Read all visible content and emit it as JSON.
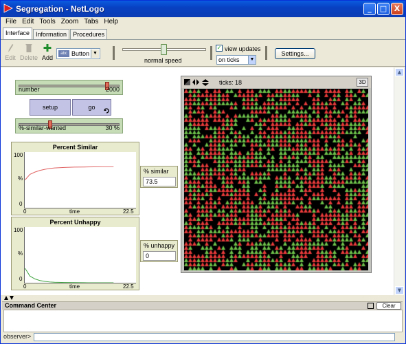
{
  "window": {
    "title": "Segregation - NetLogo",
    "min_glyph": "_",
    "max_glyph": "□",
    "close_glyph": "X"
  },
  "menu": [
    "File",
    "Edit",
    "Tools",
    "Zoom",
    "Tabs",
    "Help"
  ],
  "tabs": [
    "Interface",
    "Information",
    "Procedures"
  ],
  "toolbar": {
    "edit": "Edit",
    "delete": "Delete",
    "add": "Add",
    "widget_type": "Button",
    "widget_abc": "abc",
    "speed_label": "normal speed",
    "speed_fraction": 0.5,
    "view_updates_label": "view updates",
    "view_updates_checked": "✓",
    "update_mode": "on ticks",
    "settings": "Settings..."
  },
  "widgets": {
    "number": {
      "label": "number",
      "value": "2000",
      "fraction": 0.88
    },
    "setup": "setup",
    "go": "go",
    "go_icon": "forever-icon",
    "similar": {
      "label": "%-similar-wanted",
      "value": "30 %",
      "fraction": 0.3
    },
    "plot_similar": {
      "title": "Percent Similar",
      "ymax": "100",
      "ymin": "0",
      "xmin": "0",
      "xmax": "22.5",
      "xlabel": "time",
      "ylabel": "%"
    },
    "plot_unhappy": {
      "title": "Percent Unhappy",
      "ymax": "100",
      "ymin": "0",
      "xmin": "0",
      "xmax": "22.5",
      "xlabel": "time",
      "ylabel": "%"
    },
    "mon_similar": {
      "label": "% similar",
      "value": "73.5"
    },
    "mon_unhappy": {
      "label": "% unhappy",
      "value": "0"
    }
  },
  "view": {
    "ticks": "ticks: 18",
    "three_d": "3D"
  },
  "command_center": {
    "title": "Command Center",
    "clear": "Clear",
    "prompt": "observer>"
  },
  "colors": {
    "red_turtle": "#e83a3a",
    "green_turtle": "#6cc04a",
    "plot_line_similar": "#e06060",
    "plot_line_unhappy": "#3fa33f"
  },
  "chart_data": [
    {
      "type": "line",
      "title": "Percent Similar",
      "xlabel": "time",
      "ylabel": "%",
      "xlim": [
        0,
        22.5
      ],
      "ylim": [
        0,
        100
      ],
      "series": [
        {
          "name": "",
          "x": [
            0,
            1,
            2,
            3,
            4,
            5,
            6,
            8,
            10,
            12,
            14,
            16,
            18
          ],
          "y": [
            50,
            60,
            64,
            67,
            69,
            70.5,
            71.5,
            72.5,
            73,
            73.2,
            73.4,
            73.5,
            73.5
          ]
        }
      ]
    },
    {
      "type": "line",
      "title": "Percent Unhappy",
      "xlabel": "time",
      "ylabel": "%",
      "xlim": [
        0,
        22.5
      ],
      "ylim": [
        0,
        100
      ],
      "series": [
        {
          "name": "",
          "x": [
            0,
            1,
            2,
            3,
            4,
            5,
            6,
            8,
            10,
            12,
            14,
            16,
            18
          ],
          "y": [
            26,
            12,
            7,
            4,
            2.5,
            1.5,
            1,
            0.5,
            0.3,
            0.1,
            0,
            0,
            0
          ]
        }
      ]
    }
  ]
}
